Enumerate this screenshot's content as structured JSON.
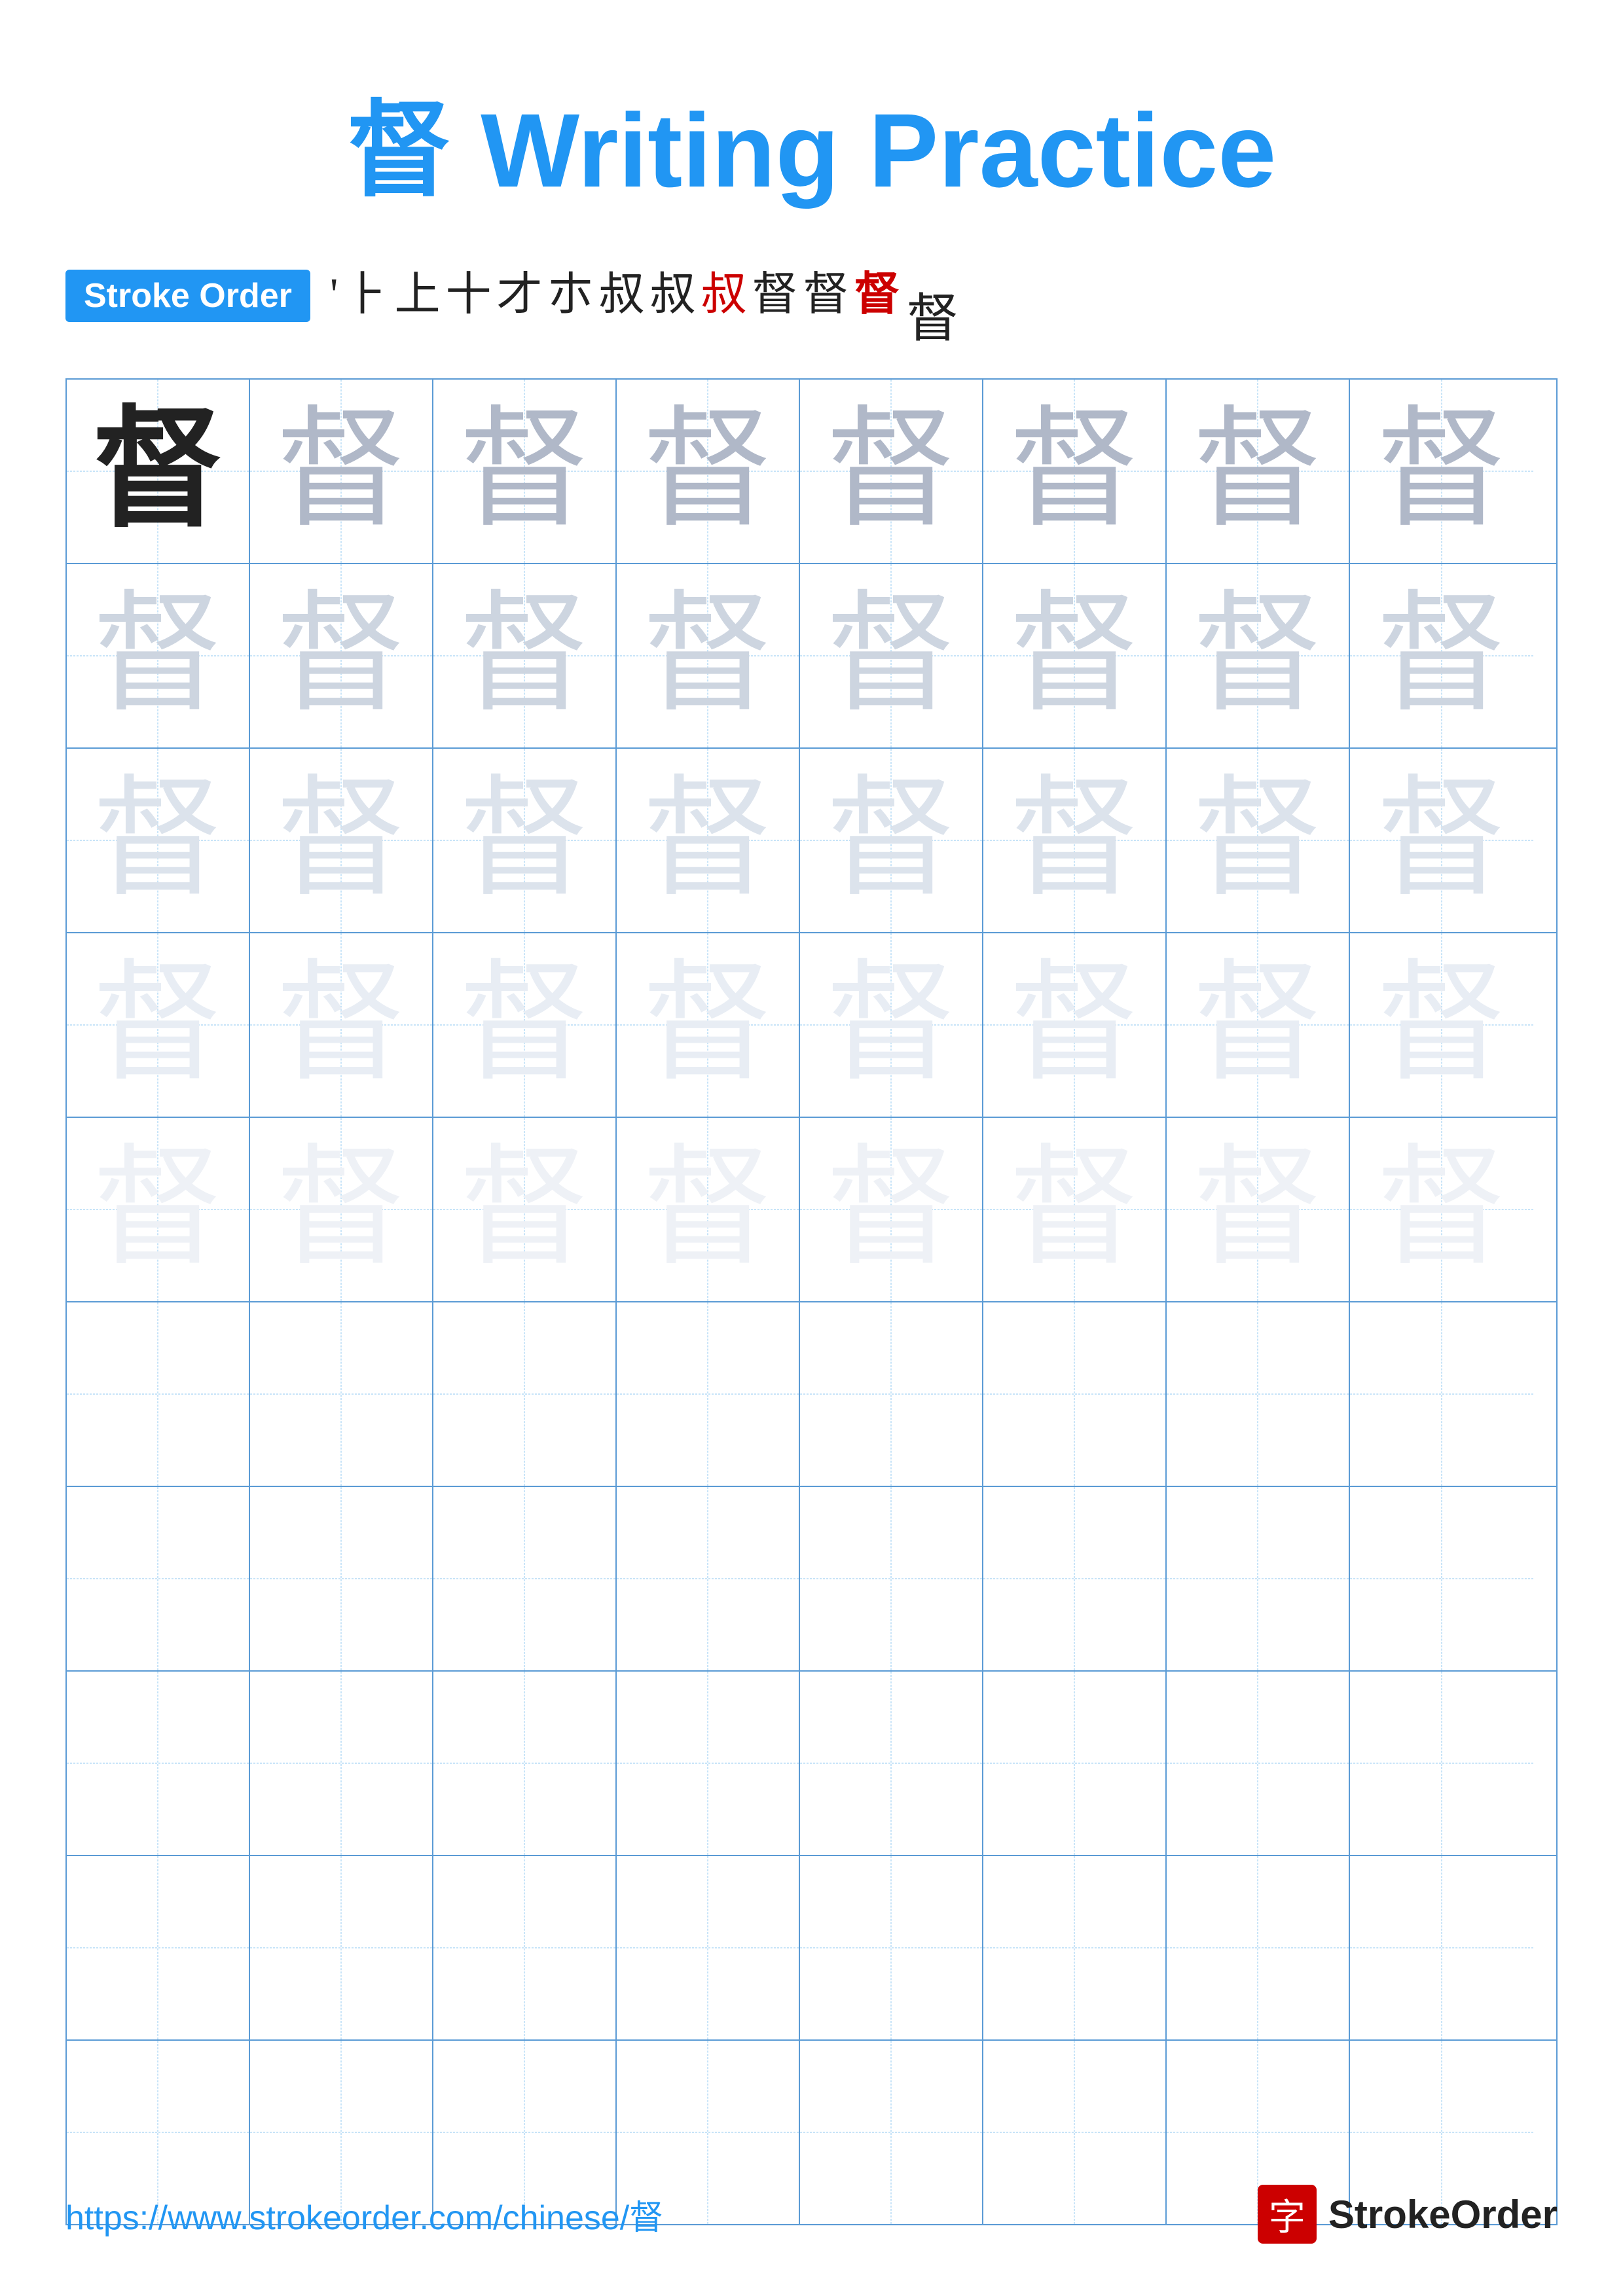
{
  "title": {
    "char": "督",
    "text": "Writing Practice",
    "full": "督 Writing Practice"
  },
  "stroke_order": {
    "badge_label": "Stroke Order",
    "strokes": [
      "'",
      "⺊",
      "上",
      "十",
      "才",
      "朩",
      "叔",
      "叔",
      "叔",
      "督",
      "督",
      "督"
    ],
    "final_char": "督"
  },
  "grid": {
    "cols": 8,
    "rows": 10,
    "char": "督",
    "practice_rows": 5,
    "empty_rows": 5
  },
  "footer": {
    "url": "https://www.strokeorder.com/chinese/督",
    "logo_char": "字",
    "logo_text": "StrokeOrder"
  }
}
